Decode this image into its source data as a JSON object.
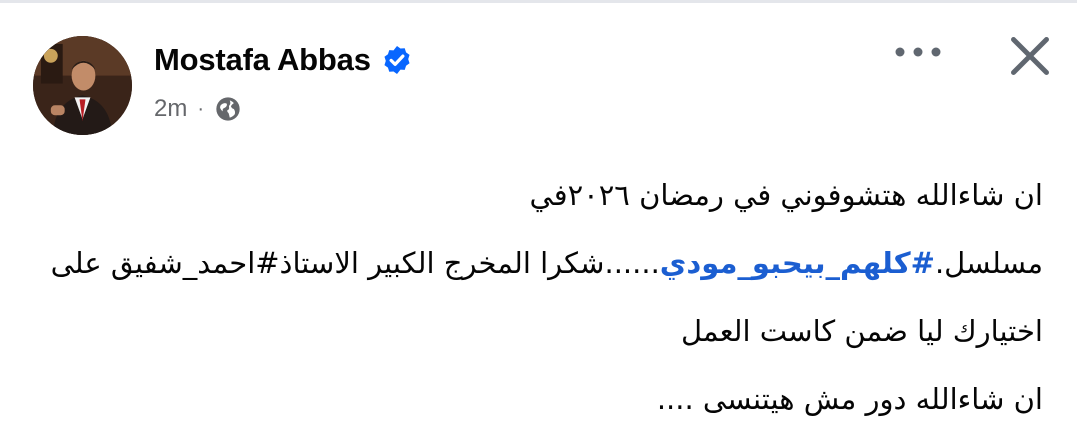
{
  "post": {
    "author_name": "Mostafa Abbas",
    "timestamp": "2m",
    "separator": "·",
    "audience_icon": "globe-icon",
    "verified_icon": "verified-badge-icon",
    "lines": {
      "line1": "ان شاءالله هتشوفوني في رمضان ٢٠٢٦في",
      "line2_before": "مسلسل.",
      "line2_hashtag": "#كلهم_بيحبو_مودي",
      "line2_after": "......شكرا المخرج الكبير الاستاذ#احمد_شفيق على",
      "line3": "اختيارك ليا ضمن كاست العمل",
      "line4": "ان شاءالله دور مش هيتنسى ...."
    }
  },
  "actions": {
    "more_icon": "more-horizontal-icon",
    "close_icon": "close-icon"
  },
  "colors": {
    "verified_blue": "#0866ff",
    "hashtag_blue": "#1b5ed1",
    "secondary_text": "#65676b",
    "icon_gray": "#606770"
  }
}
